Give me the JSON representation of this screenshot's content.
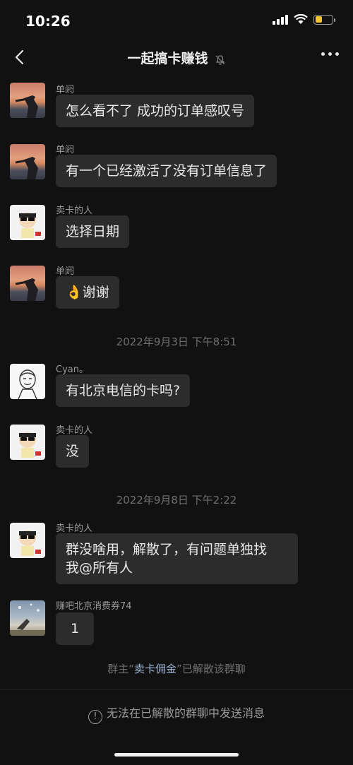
{
  "status_bar": {
    "time": "10:26"
  },
  "nav": {
    "title": "一起搞卡赚钱"
  },
  "messages": [
    {
      "sender": "单阏",
      "text": "怎么看不了 成功的订单感叹号",
      "avatar": "sunset-avatar"
    },
    {
      "sender": "单阏",
      "text": "有一个已经激活了没有订单信息了",
      "avatar": "sunset-avatar"
    },
    {
      "sender": "卖卡的人",
      "text": "选择日期",
      "avatar": "cartoon-avatar"
    },
    {
      "sender": "单阏",
      "text": "👌谢谢",
      "avatar": "sunset-avatar"
    },
    {
      "sender": "Cyan。",
      "text": "有北京电信的卡吗?",
      "avatar": "sketch-avatar"
    },
    {
      "sender": "卖卡的人",
      "text": "没",
      "avatar": "cartoon-avatar"
    },
    {
      "sender": "卖卡的人",
      "text": "群没啥用，解散了，有问题单独找\n我@所有人",
      "avatar": "cartoon-avatar"
    },
    {
      "sender": "赚吧北京消费券74",
      "text": "1",
      "avatar": "sky-avatar"
    }
  ],
  "timestamps": [
    "2022年9月3日 下午8:51",
    "2022年9月8日 下午2:22"
  ],
  "system_notice": {
    "prefix": "群主“",
    "name": "卖卡佣金",
    "suffix": "”已解散该群聊"
  },
  "footer": {
    "notice": "无法在已解散的群聊中发送消息"
  },
  "colors": {
    "background": "#111111",
    "bubble": "#2c2c2c",
    "battery": "#f5c431"
  }
}
